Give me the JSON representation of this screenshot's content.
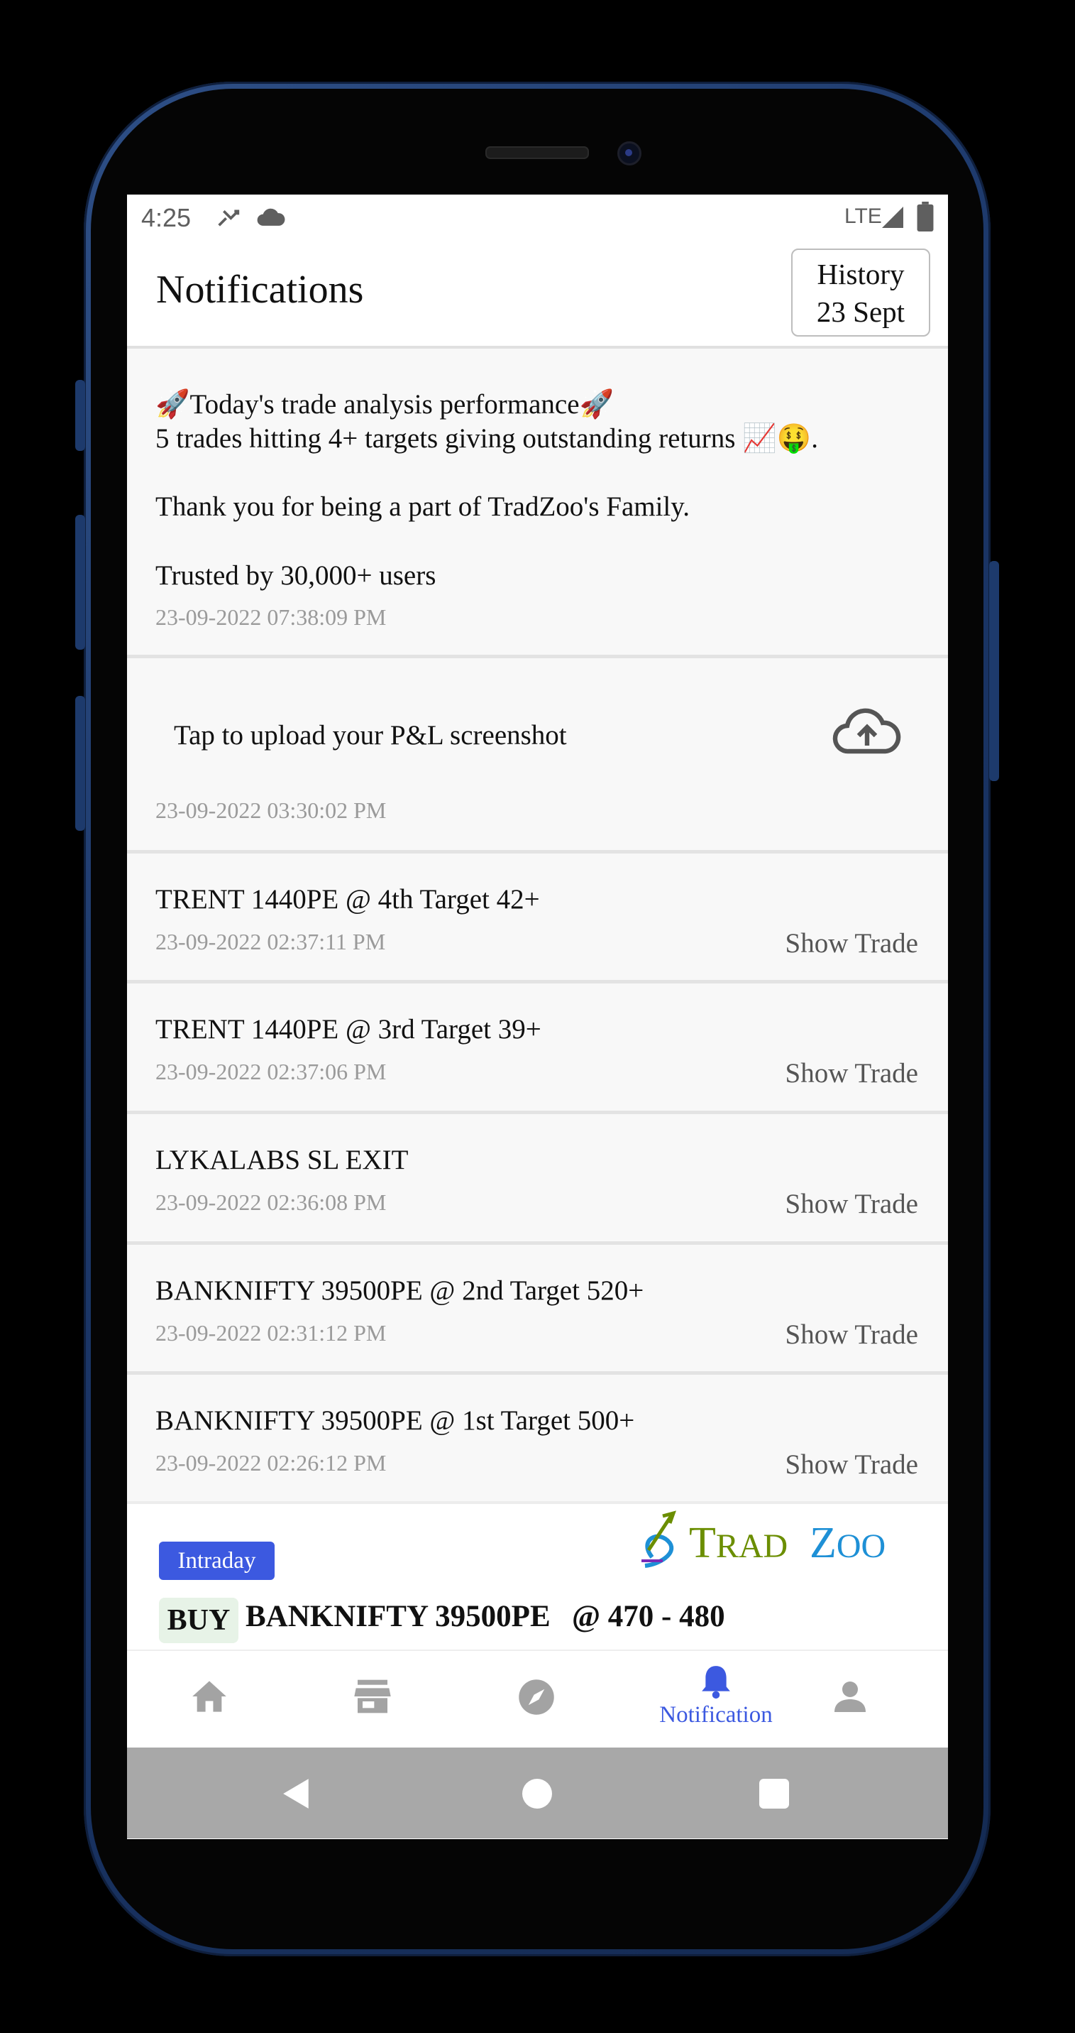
{
  "status_bar": {
    "time": "4:25",
    "network": "LTE",
    "icons": [
      "missed-call-icon",
      "cloud-icon",
      "signal-icon",
      "battery-icon"
    ]
  },
  "header": {
    "title": "Notifications",
    "history_line1": "History",
    "history_line2": "23 Sept"
  },
  "announcement": {
    "line1": "🚀Today's trade analysis performance🚀",
    "line2": "5 trades hitting 4+ targets giving outstanding returns 📈🤑.",
    "line3": "Thank you for being a part of TradZoo's Family.",
    "line4": "Trusted by 30,000+ users",
    "time": "23-09-2022 07:38:09 PM"
  },
  "upload": {
    "text": "Tap to upload your P&L screenshot",
    "time": "23-09-2022 03:30:02 PM",
    "icon": "cloud-upload-icon"
  },
  "notifications": [
    {
      "title": "TRENT 1440PE @ 4th Target 42+",
      "time": "23-09-2022 02:37:11 PM",
      "action": "Show Trade"
    },
    {
      "title": "TRENT 1440PE @ 3rd Target 39+",
      "time": "23-09-2022 02:37:06 PM",
      "action": "Show Trade"
    },
    {
      "title": "LYKALABS SL EXIT",
      "time": "23-09-2022 02:36:08 PM",
      "action": "Show Trade"
    },
    {
      "title": "BANKNIFTY 39500PE @ 2nd Target 520+",
      "time": "23-09-2022 02:31:12 PM",
      "action": "Show Trade"
    },
    {
      "title": "BANKNIFTY 39500PE @ 1st Target 500+",
      "time": "23-09-2022 02:26:12 PM",
      "action": "Show Trade"
    }
  ],
  "trade_panel": {
    "badge": "Intraday",
    "logo": "TRADZOO",
    "side": "BUY",
    "symbol": "BANKNIFTY 39500PE",
    "price": "@ 470 - 480"
  },
  "bottom_nav": {
    "items": [
      "home-icon",
      "store-icon",
      "explore-icon",
      "bell-icon",
      "profile-icon"
    ],
    "active_label": "Notification"
  },
  "colors": {
    "accent": "#3c59e0",
    "inactive_icon": "#a3a3a3",
    "logo_green": "#6b8e00",
    "logo_blue": "#1e90d6"
  }
}
